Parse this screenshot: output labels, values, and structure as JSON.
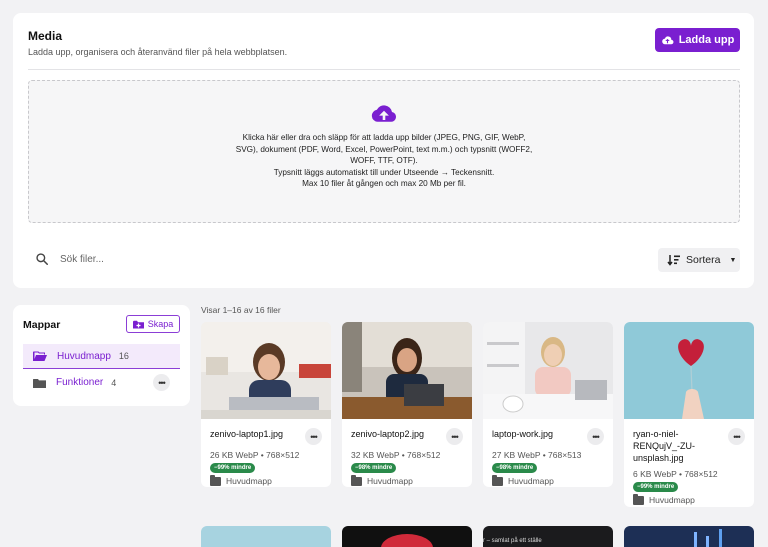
{
  "header": {
    "title": "Media",
    "subtitle": "Ladda upp, organisera och återanvänd filer på hela webbplatsen.",
    "upload_button": "Ladda upp"
  },
  "dropzone": {
    "lines": [
      "Klicka här eller dra och släpp för att ladda upp bilder (JPEG, PNG, GIF, WebP,",
      "SVG), dokument (PDF, Word, Excel, PowerPoint, text m.m.) och typsnitt (WOFF2,",
      "WOFF, TTF, OTF).",
      "Typsnitt läggs automatiskt till under Utseende → Teckensnitt.",
      "Max 10 filer åt gången och max 20 Mb per fil."
    ]
  },
  "search": {
    "placeholder": "Sök filer...",
    "value": ""
  },
  "sort": {
    "label": "Sortera"
  },
  "folders": {
    "title": "Mappar",
    "create_label": "Skapa",
    "items": [
      {
        "name": "Huvudmapp",
        "count": "16",
        "active": true
      },
      {
        "name": "Funktioner",
        "count": "4",
        "active": false
      }
    ]
  },
  "files": {
    "count_text": "Visar 1–16 av 16 filer",
    "items": [
      {
        "name": "zenivo-laptop1.jpg",
        "meta": "26 KB WebP • 768×512",
        "badge": "−99% mindre",
        "folder": "Huvudmapp"
      },
      {
        "name": "zenivo-laptop2.jpg",
        "meta": "32 KB WebP • 768×512",
        "badge": "−98% mindre",
        "folder": "Huvudmapp"
      },
      {
        "name": "laptop-work.jpg",
        "meta": "27 KB WebP • 768×513",
        "badge": "−98% mindre",
        "folder": "Huvudmapp"
      },
      {
        "name": "ryan-o-niel-RENQujV_-ZU-unsplash.jpg",
        "name_lines": [
          "ryan-o-niel-",
          "RENQujV_-ZU-",
          "unsplash.jpg"
        ],
        "meta": "6 KB WebP • 768×512",
        "badge": "−99% mindre",
        "folder": "Huvudmapp"
      }
    ],
    "partial_row_caption": "r – samlat på ett ställe"
  },
  "colors": {
    "accent": "#7a1fd0",
    "badge": "#2a8a4a",
    "background": "#f2f2f4"
  }
}
